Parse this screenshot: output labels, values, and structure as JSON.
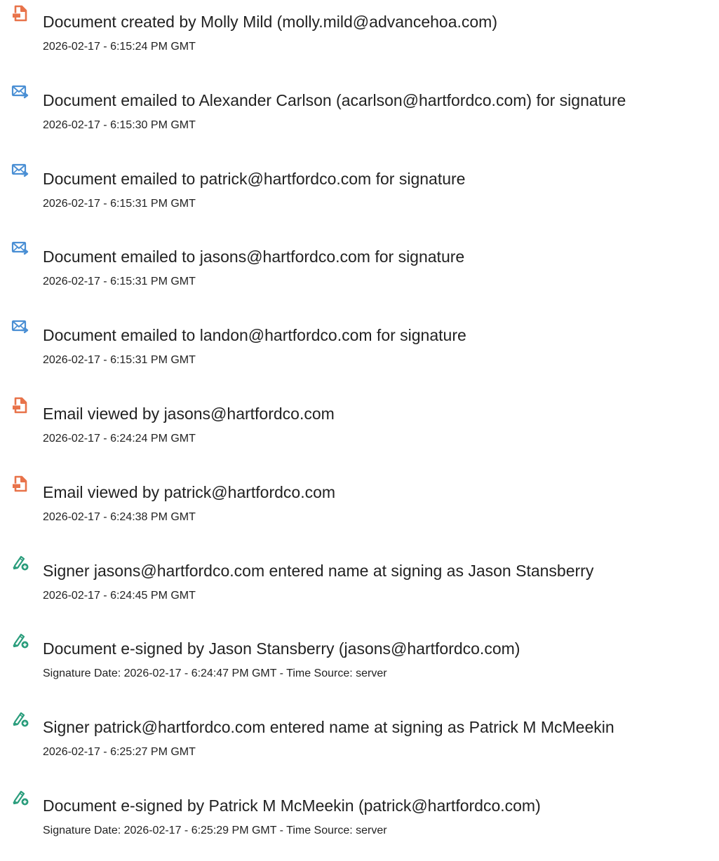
{
  "events": [
    {
      "icon": "document-icon",
      "title": "Document created by Molly Mild (molly.mild@advancehoa.com)",
      "time": "2026-02-17 - 6:15:24 PM GMT"
    },
    {
      "icon": "email-sent-icon",
      "title": "Document emailed to Alexander Carlson (acarlson@hartfordco.com) for signature",
      "time": "2026-02-17 - 6:15:30 PM GMT"
    },
    {
      "icon": "email-sent-icon",
      "title": "Document emailed to patrick@hartfordco.com for signature",
      "time": "2026-02-17 - 6:15:31 PM GMT"
    },
    {
      "icon": "email-sent-icon",
      "title": "Document emailed to jasons@hartfordco.com for signature",
      "time": "2026-02-17 - 6:15:31 PM GMT"
    },
    {
      "icon": "email-sent-icon",
      "title": "Document emailed to landon@hartfordco.com for signature",
      "time": "2026-02-17 - 6:15:31 PM GMT"
    },
    {
      "icon": "document-icon",
      "title": "Email viewed by jasons@hartfordco.com",
      "time": "2026-02-17 - 6:24:24 PM GMT"
    },
    {
      "icon": "document-icon",
      "title": "Email viewed by patrick@hartfordco.com",
      "time": "2026-02-17 - 6:24:38 PM GMT"
    },
    {
      "icon": "esign-pen-icon",
      "title": "Signer jasons@hartfordco.com entered name at signing as Jason Stansberry",
      "time": "2026-02-17 - 6:24:45 PM GMT"
    },
    {
      "icon": "esign-pen-icon",
      "title": "Document e-signed by Jason Stansberry (jasons@hartfordco.com)",
      "time": "Signature Date: 2026-02-17 - 6:24:47 PM GMT - Time Source: server"
    },
    {
      "icon": "esign-pen-icon",
      "title": "Signer patrick@hartfordco.com entered name at signing as Patrick M McMeekin",
      "time": "2026-02-17 - 6:25:27 PM GMT"
    },
    {
      "icon": "esign-pen-icon",
      "title": "Document e-signed by Patrick M McMeekin (patrick@hartfordco.com)",
      "time": "Signature Date: 2026-02-17 - 6:25:29 PM GMT - Time Source: server"
    }
  ],
  "colors": {
    "document_icon": "#e8734a",
    "email_icon": "#4a8fd4",
    "esign_icon": "#2a9d7c"
  }
}
